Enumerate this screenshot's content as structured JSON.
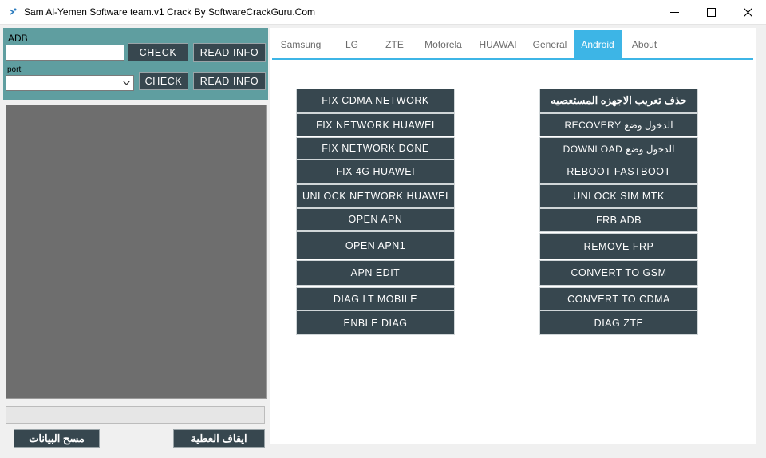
{
  "window": {
    "title": "Sam Al-Yemen Software team.v1 Crack By SoftwareCrackGuru.Com",
    "controls": [
      "minimize-icon",
      "maximize-icon",
      "close-icon"
    ]
  },
  "left": {
    "adb_label": "ADB",
    "adb_value": "",
    "port_label": "port",
    "port_value": "",
    "check_label": "CHECK",
    "read_info_label": "READ INFO",
    "clear_data_label": "مسح البيانات",
    "stop_label": "ايقاف العطية"
  },
  "tabs": [
    "Samsung",
    "LG",
    "ZTE",
    "Motorela",
    "HUAWAI",
    "General",
    "Android",
    "About"
  ],
  "active_tab": "Android",
  "colors": {
    "accent": "#3db5e6",
    "button_bg": "#37474f",
    "panel_teal": "#5f9ea0",
    "log_bg": "#6e6e6e"
  },
  "android": {
    "left_buttons": [
      "FIX CDMA NETWORK",
      "FIX NETWORK HUAWEI",
      "FIX NETWORK DONE",
      "FIX 4G HUAWEI",
      "UNLOCK NETWORK HUAWEI",
      "OPEN APN",
      "OPEN APN1",
      "APN EDIT",
      "DIAG LT MOBILE",
      "ENBLE DIAG"
    ],
    "right_buttons": [
      "حذف تعريب الاجهزه المستعصيه",
      "RECOVERY الدخول وضع",
      "DOWNLOAD الدخول وضع",
      "REBOOT FASTBOOT",
      "UNLOCK SIM MTK",
      "FRB ADB",
      "REMOVE FRP",
      "CONVERT TO GSM",
      "CONVERT TO CDMA",
      "DIAG ZTE"
    ]
  }
}
